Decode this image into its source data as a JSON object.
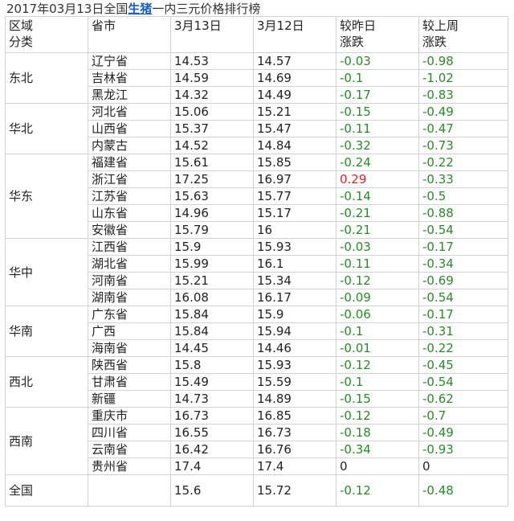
{
  "title": {
    "prefix": "2017年03月13日全国",
    "link": "生猪",
    "suffix": "一内三元价格排行榜"
  },
  "headers": {
    "region": [
      "区域",
      "分类"
    ],
    "province": "省市",
    "date1": "3月13日",
    "date2": "3月12日",
    "daily": [
      "较昨日",
      "涨跌"
    ],
    "weekly": [
      "较上周",
      "涨跌"
    ]
  },
  "regions": [
    {
      "name": "东北",
      "rows": [
        {
          "province": "辽宁省",
          "d13": "14.53",
          "d12": "14.57",
          "daily": "-0.03",
          "weekly": "-0.98"
        },
        {
          "province": "吉林省",
          "d13": "14.59",
          "d12": "14.69",
          "daily": "-0.1",
          "weekly": "-1.02"
        },
        {
          "province": "黑龙江",
          "d13": "14.32",
          "d12": "14.49",
          "daily": "-0.17",
          "weekly": "-0.83"
        }
      ]
    },
    {
      "name": "华北",
      "rows": [
        {
          "province": "河北省",
          "d13": "15.06",
          "d12": "15.21",
          "daily": "-0.15",
          "weekly": "-0.49"
        },
        {
          "province": "山西省",
          "d13": "15.37",
          "d12": "15.47",
          "daily": "-0.11",
          "weekly": "-0.47"
        },
        {
          "province": "内蒙古",
          "d13": "14.52",
          "d12": "14.84",
          "daily": "-0.32",
          "weekly": "-0.73"
        }
      ]
    },
    {
      "name": "华东",
      "rows": [
        {
          "province": "福建省",
          "d13": "15.61",
          "d12": "15.85",
          "daily": "-0.24",
          "weekly": "-0.22"
        },
        {
          "province": "浙江省",
          "d13": "17.25",
          "d12": "16.97",
          "daily": "0.29",
          "weekly": "-0.33"
        },
        {
          "province": "江苏省",
          "d13": "15.63",
          "d12": "15.77",
          "daily": "-0.14",
          "weekly": "-0.5"
        },
        {
          "province": "山东省",
          "d13": "14.96",
          "d12": "15.17",
          "daily": "-0.21",
          "weekly": "-0.88"
        },
        {
          "province": "安徽省",
          "d13": "15.79",
          "d12": "16",
          "daily": "-0.21",
          "weekly": "-0.54"
        }
      ]
    },
    {
      "name": "华中",
      "rows": [
        {
          "province": "江西省",
          "d13": "15.9",
          "d12": "15.93",
          "daily": "-0.03",
          "weekly": "-0.17"
        },
        {
          "province": "湖北省",
          "d13": "15.99",
          "d12": "16.1",
          "daily": "-0.11",
          "weekly": "-0.34"
        },
        {
          "province": "河南省",
          "d13": "15.21",
          "d12": "15.34",
          "daily": "-0.12",
          "weekly": "-0.69"
        },
        {
          "province": "湖南省",
          "d13": "16.08",
          "d12": "16.17",
          "daily": "-0.09",
          "weekly": "-0.54"
        }
      ]
    },
    {
      "name": "华南",
      "rows": [
        {
          "province": "广东省",
          "d13": "15.84",
          "d12": "15.9",
          "daily": "-0.06",
          "weekly": "-0.17"
        },
        {
          "province": "广西",
          "d13": "15.84",
          "d12": "15.94",
          "daily": "-0.1",
          "weekly": "-0.31"
        },
        {
          "province": "海南省",
          "d13": "14.45",
          "d12": "14.46",
          "daily": "-0.01",
          "weekly": "-0.22"
        }
      ]
    },
    {
      "name": "西北",
      "rows": [
        {
          "province": "陕西省",
          "d13": "15.8",
          "d12": "15.93",
          "daily": "-0.12",
          "weekly": "-0.45"
        },
        {
          "province": "甘肃省",
          "d13": "15.49",
          "d12": "15.59",
          "daily": "-0.1",
          "weekly": "-0.54"
        },
        {
          "province": "新疆",
          "d13": "14.73",
          "d12": "14.89",
          "daily": "-0.15",
          "weekly": "-0.62"
        }
      ]
    },
    {
      "name": "西南",
      "rows": [
        {
          "province": "重庆市",
          "d13": "16.73",
          "d12": "16.85",
          "daily": "-0.12",
          "weekly": "-0.7"
        },
        {
          "province": "四川省",
          "d13": "16.55",
          "d12": "16.73",
          "daily": "-0.18",
          "weekly": "-0.49"
        },
        {
          "province": "云南省",
          "d13": "16.42",
          "d12": "16.76",
          "daily": "-0.34",
          "weekly": "-0.93"
        },
        {
          "province": "贵州省",
          "d13": "17.4",
          "d12": "17.4",
          "daily": "0",
          "weekly": "0"
        }
      ]
    }
  ],
  "total": {
    "name": "全国",
    "province": "",
    "d13": "15.6",
    "d12": "15.72",
    "daily": "-0.12",
    "weekly": "-0.48"
  },
  "colors": {
    "up": "#e0222a",
    "down": "#2a8a2a",
    "link": "#1a5fb4",
    "border": "#d2d2d2"
  }
}
